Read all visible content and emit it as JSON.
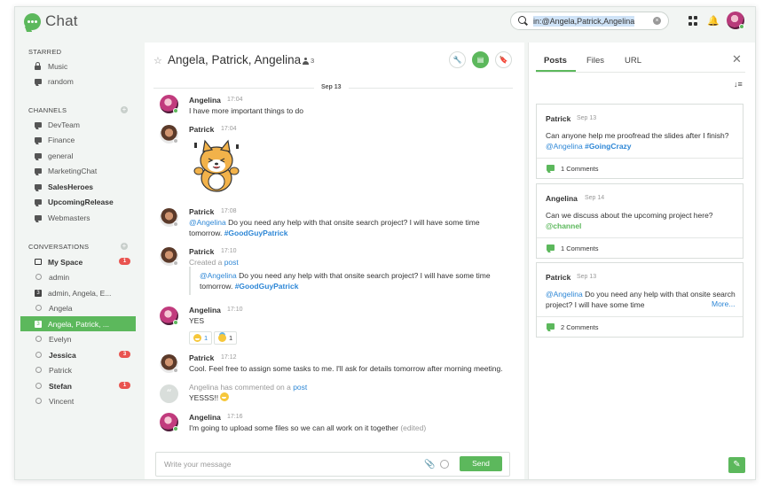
{
  "app": {
    "title": "Chat"
  },
  "search": {
    "value": "in:@Angela,Patrick,Angelina",
    "clear": "×"
  },
  "header_icons": {
    "apps": "grid-icon",
    "notifications": "bell-icon",
    "bell_glyph": "🔔"
  },
  "sidebar": {
    "starred": {
      "title": "STARRED",
      "items": [
        {
          "label": "Music",
          "icon": "lock-icon"
        },
        {
          "label": "random",
          "icon": "chat-bubble-icon"
        }
      ]
    },
    "channels": {
      "title": "CHANNELS",
      "add": "+",
      "items": [
        {
          "label": "DevTeam",
          "bold": false
        },
        {
          "label": "Finance",
          "bold": false
        },
        {
          "label": "general",
          "bold": false
        },
        {
          "label": "MarketingChat",
          "bold": false
        },
        {
          "label": "SalesHeroes",
          "bold": true
        },
        {
          "label": "UpcomingRelease",
          "bold": true
        },
        {
          "label": "Webmasters",
          "bold": false
        }
      ]
    },
    "conversations": {
      "title": "CONVERSATIONS",
      "add": "+",
      "items": [
        {
          "label": "My Space",
          "icon": "inbox-icon",
          "bold": true,
          "badge": "1"
        },
        {
          "label": "admin",
          "icon": "circle-icon"
        },
        {
          "label": "admin, Angela, E...",
          "icon": "group-icon",
          "glyph": "3"
        },
        {
          "label": "Angela",
          "icon": "circle-icon"
        },
        {
          "label": "Angela, Patrick, ...",
          "icon": "group-icon",
          "glyph": "3",
          "active": true
        },
        {
          "label": "Evelyn",
          "icon": "circle-icon"
        },
        {
          "label": "Jessica",
          "icon": "circle-icon",
          "bold": true,
          "badge": "3"
        },
        {
          "label": "Patrick",
          "icon": "circle-icon"
        },
        {
          "label": "Stefan",
          "icon": "circle-icon",
          "bold": true,
          "badge": "1"
        },
        {
          "label": "Vincent",
          "icon": "circle-icon"
        }
      ]
    }
  },
  "chat": {
    "title": "Angela, Patrick, Angelina",
    "member_count": "3",
    "star": "☆",
    "buttons": {
      "settings": "🔧",
      "details": "▤",
      "bookmark": "🔖"
    },
    "date_divider": "Sep 13",
    "messages": [
      {
        "author": "Angelina",
        "time": "17:04",
        "text": "I have more important things to do"
      },
      {
        "author": "Patrick",
        "time": "17:04"
      },
      {
        "author": "Patrick",
        "time": "17:08",
        "mention": "@Angelina",
        "text": " Do you need any help with that onsite search project? I will have some time tomorrow. ",
        "tag": "#GoodGuyPatrick"
      },
      {
        "author": "Patrick",
        "time": "17:10",
        "prefix": "Created a ",
        "link": "post",
        "quote_mention": "@Angelina",
        "quote_text": " Do you need any help with that onsite search project? I will have some time tomorrow. ",
        "quote_tag": "#GoodGuyPatrick"
      },
      {
        "author": "Angelina",
        "time": "17:10",
        "text": "YES",
        "reactions": [
          {
            "emoji": "grin",
            "count": "1"
          },
          {
            "emoji": "halo",
            "count": "1"
          }
        ]
      },
      {
        "author": "Patrick",
        "time": "17:12",
        "text": "Cool. Feel free to assign some tasks to me. I'll ask for details tomorrow after morning meeting."
      },
      {
        "author": "Angelina",
        "action": " has commented on a ",
        "link": "post",
        "text": "YESSS!! ",
        "avatar": "“"
      },
      {
        "author": "Angelina",
        "time": "17:16",
        "text": "I'm going to upload some files so we can all work on it together ",
        "edited": "(edited)"
      }
    ],
    "composer": {
      "placeholder": "Write your message",
      "send": "Send",
      "attach": "📎"
    }
  },
  "panel": {
    "tabs": [
      "Posts",
      "Files",
      "URL"
    ],
    "close": "✕",
    "sort": "↓≡",
    "posts": [
      {
        "author": "Patrick",
        "date": "Sep 13",
        "text": "Can anyone help me proofread the slides after I finish? ",
        "mention": "@Angelina",
        "tag": "#GoingCrazy",
        "comments": "1 Comments"
      },
      {
        "author": "Angelina",
        "date": "Sep 14",
        "text": "Can we discuss about the upcoming project here? ",
        "mention": "@channel",
        "comments": "1 Comments"
      },
      {
        "author": "Patrick",
        "date": "Sep 13",
        "mention": "@Angelina",
        "text": " Do you need any help with that onsite search project? I will have some time",
        "more": "More...",
        "comments": "2 Comments"
      }
    ],
    "compose": "✎"
  },
  "colors": {
    "accent": "#5cb85c",
    "link": "#2e87d6",
    "badge": "#e9534f"
  }
}
